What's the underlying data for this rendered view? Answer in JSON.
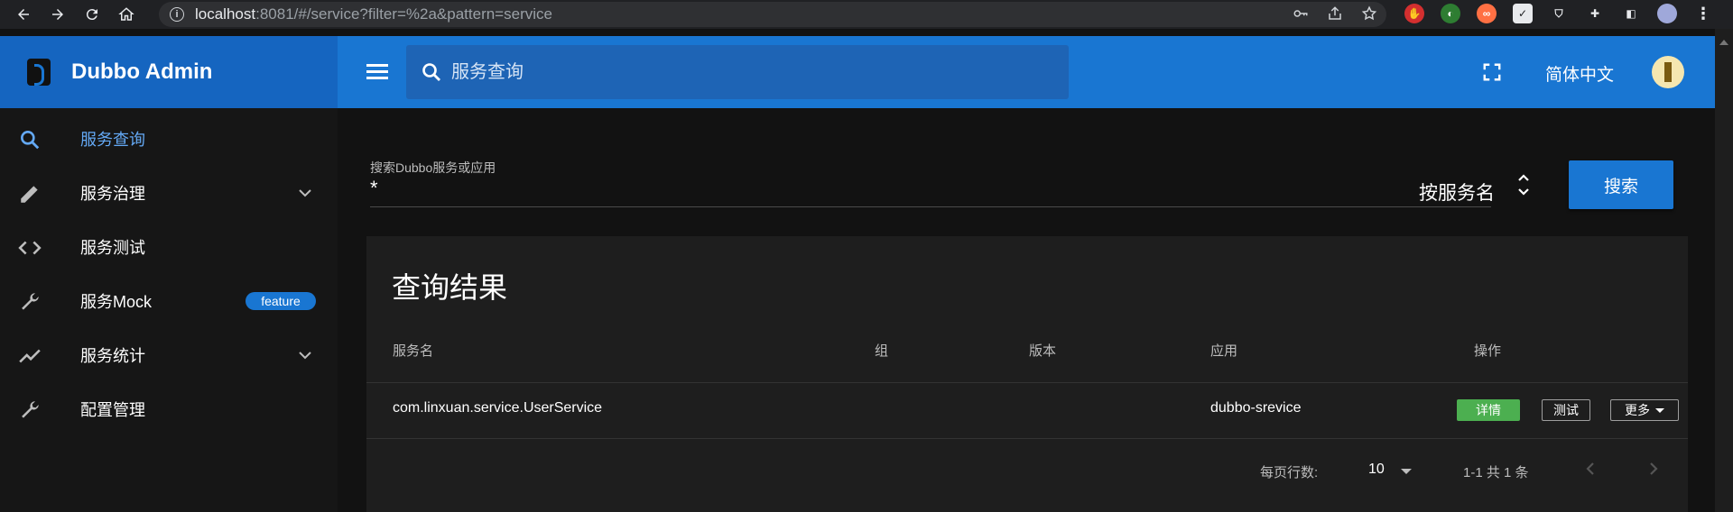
{
  "browser": {
    "url_host": "localhost",
    "url_rest": ":8081/#/service?filter=%2a&pattern=service"
  },
  "header": {
    "brand_title": "Dubbo Admin",
    "search_placeholder": "服务查询",
    "language": "简体中文"
  },
  "sidebar": {
    "items": [
      {
        "label": "服务查询",
        "icon": "search-icon",
        "active": true
      },
      {
        "label": "服务治理",
        "icon": "pencil-icon",
        "expandable": true
      },
      {
        "label": "服务测试",
        "icon": "code-icon"
      },
      {
        "label": "服务Mock",
        "icon": "wrench-icon",
        "badge": "feature"
      },
      {
        "label": "服务统计",
        "icon": "trending-icon",
        "expandable": true
      },
      {
        "label": "配置管理",
        "icon": "wrench-icon"
      }
    ]
  },
  "search": {
    "label": "搜索Dubbo服务或应用",
    "value": "*",
    "by": "按服务名",
    "button": "搜索"
  },
  "results": {
    "title": "查询结果",
    "columns": [
      "服务名",
      "组",
      "版本",
      "应用",
      "操作"
    ],
    "rows": [
      {
        "service": "com.linxuan.service.UserService",
        "group": "",
        "version": "",
        "app": "dubbo-srevice"
      }
    ],
    "actions": {
      "detail": "详情",
      "test": "测试",
      "more": "更多"
    },
    "footer": {
      "rows_per_page_label": "每页行数:",
      "rows_per_page": "10",
      "range": "1-1 共 1 条"
    }
  },
  "colors": {
    "primary": "#1976d2",
    "brand_bg": "#1565c0",
    "success": "#4caf50",
    "active_text": "#64a9f5"
  }
}
